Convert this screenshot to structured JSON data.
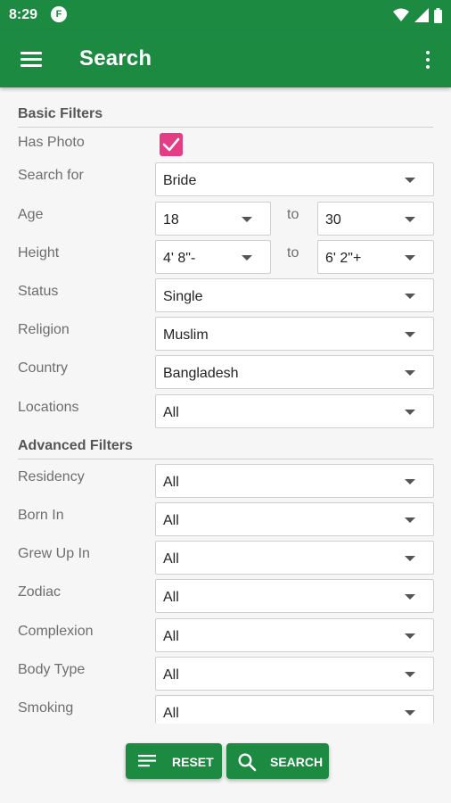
{
  "status_bar": {
    "time": "8:29",
    "app_icon_letter": "F"
  },
  "app_bar": {
    "title": "Search",
    "menu_icon": "hamburger-icon",
    "overflow_icon": "more-vert-icon"
  },
  "basic_filters": {
    "header": "Basic Filters",
    "has_photo": {
      "label": "Has Photo",
      "checked": true
    },
    "search_for": {
      "label": "Search for",
      "value": "Bride"
    },
    "age": {
      "label": "Age",
      "from": "18",
      "to_label": "to",
      "to": "30"
    },
    "height": {
      "label": "Height",
      "from": "4' 8\"-",
      "to_label": "to",
      "to": "6' 2\"+"
    },
    "status": {
      "label": "Status",
      "value": "Single"
    },
    "religion": {
      "label": "Religion",
      "value": "Muslim"
    },
    "country": {
      "label": "Country",
      "value": "Bangladesh"
    },
    "locations": {
      "label": "Locations",
      "value": "All"
    }
  },
  "advanced_filters": {
    "header": "Advanced Filters",
    "residency": {
      "label": "Residency",
      "value": "All"
    },
    "born_in": {
      "label": "Born In",
      "value": "All"
    },
    "grew_up_in": {
      "label": "Grew Up In",
      "value": "All"
    },
    "zodiac": {
      "label": "Zodiac",
      "value": "All"
    },
    "complexion": {
      "label": "Complexion",
      "value": "All"
    },
    "body_type": {
      "label": "Body Type",
      "value": "All"
    },
    "smoking": {
      "label": "Smoking",
      "value": "All"
    }
  },
  "actions": {
    "reset_label": "RESET",
    "search_label": "SEARCH"
  },
  "colors": {
    "primary": "#1d8a42",
    "checkbox": "#e53d85"
  }
}
